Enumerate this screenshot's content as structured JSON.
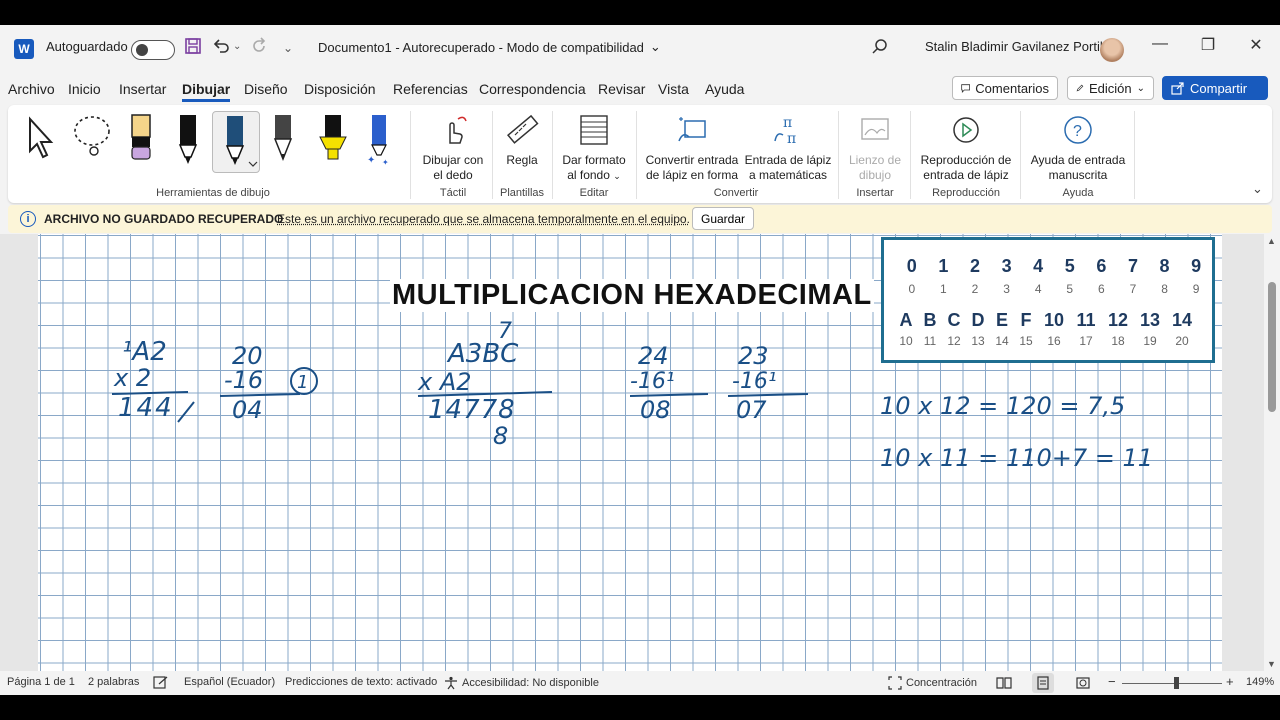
{
  "titlebar": {
    "app_icon": "W",
    "autosave_label": "Autoguardado",
    "doc_title": "Documento1  -  Autorecuperado  -  Modo de compatibilidad",
    "user_name": "Stalin Bladimir Gavilanez Portilla"
  },
  "menu": {
    "items": [
      "Archivo",
      "Inicio",
      "Insertar",
      "Dibujar",
      "Diseño",
      "Disposición",
      "Referencias",
      "Correspondencia",
      "Revisar",
      "Vista",
      "Ayuda"
    ],
    "active": "Dibujar",
    "comentarios": "Comentarios",
    "edicion": "Edición",
    "compartir": "Compartir"
  },
  "ribbon": {
    "groups": {
      "herramientas": "Herramientas de dibujo",
      "tactil": "Táctil",
      "plantillas": "Plantillas",
      "editar": "Editar",
      "convertir": "Convertir",
      "insertar": "Insertar",
      "reproduccion": "Reproducción",
      "ayuda": "Ayuda"
    },
    "buttons": {
      "dibujar_dedo_1": "Dibujar con",
      "dibujar_dedo_2": "el dedo",
      "regla": "Regla",
      "formato_1": "Dar formato",
      "formato_2": "al fondo",
      "convertir_forma_1": "Convertir entrada",
      "convertir_forma_2": "de lápiz en forma",
      "matematicas_1": "Entrada de lápiz",
      "matematicas_2": "a matemáticas",
      "lienzo_1": "Lienzo de",
      "lienzo_2": "dibujo",
      "reproduccion_1": "Reproducción de",
      "reproduccion_2": "entrada de lápiz",
      "ayuda_1": "Ayuda de entrada",
      "ayuda_2": "manuscrita"
    },
    "pen_colors": [
      "#f5d58a",
      "#111111",
      "#1f4e79",
      "#444444",
      "#f5e100",
      "#2b5fcc"
    ]
  },
  "infobar": {
    "title": "ARCHIVO NO GUARDADO RECUPERADO",
    "text": "Este es un archivo recuperado que se almacena temporalmente en el equipo.",
    "button": "Guardar"
  },
  "document": {
    "heading": "MULTIPLICACION HEXADECIMAL",
    "hex_table": {
      "row1_big": [
        "0",
        "1",
        "2",
        "3",
        "4",
        "5",
        "6",
        "7",
        "8",
        "9"
      ],
      "row1_small": [
        "0",
        "1",
        "2",
        "3",
        "4",
        "5",
        "6",
        "7",
        "8",
        "9"
      ],
      "row2_big": [
        "A",
        "B",
        "C",
        "D",
        "E",
        "F",
        "10",
        "11",
        "12",
        "13",
        "14"
      ],
      "row2_small": [
        "10",
        "11",
        "12",
        "13",
        "14",
        "15",
        "16",
        "17",
        "18",
        "19",
        "20"
      ]
    },
    "handwriting": {
      "ex1_top": "¹A2",
      "ex1_mult": "x   2",
      "ex1_result": "144",
      "ex2_top": "20",
      "ex2_sub": "-16",
      "ex2_circle": "1",
      "ex2_result": "04",
      "ex3_carry": "7",
      "ex3_top": "A3BC",
      "ex3_mult": "x   A2",
      "ex3_result": "14778",
      "ex3_below": "8",
      "ex4_top": "24",
      "ex4_sub": "-16¹",
      "ex4_result": "08",
      "ex5_top": "23",
      "ex5_sub": "-16¹",
      "ex5_result": "07",
      "eq1": "10 x 12  =  120   = 7,5",
      "eq2": "10 x 11  =  110+7 = 11"
    },
    "ink_color": "#1a4f86"
  },
  "status": {
    "page": "Página 1 de 1",
    "words": "2 palabras",
    "language": "Español (Ecuador)",
    "predictions": "Predicciones de texto: activado",
    "accessibility": "Accesibilidad: No disponible",
    "focus": "Concentración",
    "zoom": "149%"
  }
}
